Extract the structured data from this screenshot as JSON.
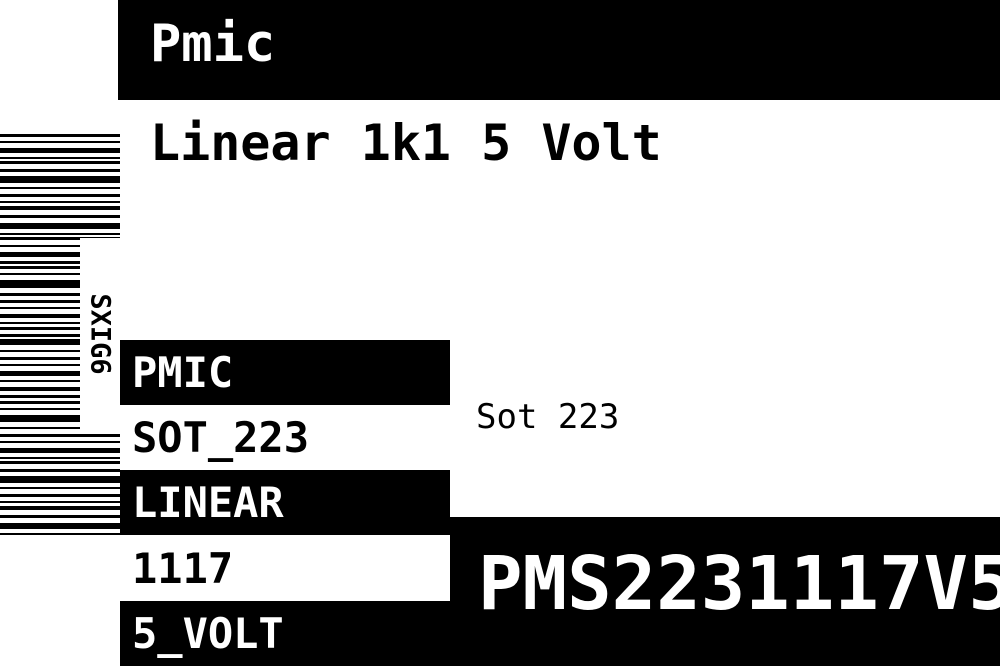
{
  "label": {
    "category": "Pmic",
    "description": "Linear 1k1 5 Volt",
    "barcode_id": "SXIG6",
    "tags": [
      "PMIC",
      "SOT_223",
      "LINEAR",
      "1117",
      "5_VOLT"
    ],
    "package": "Sot 223",
    "part_number": "PMS2231117V5"
  },
  "colors": {
    "foreground": "#000000",
    "background": "#ffffff"
  }
}
